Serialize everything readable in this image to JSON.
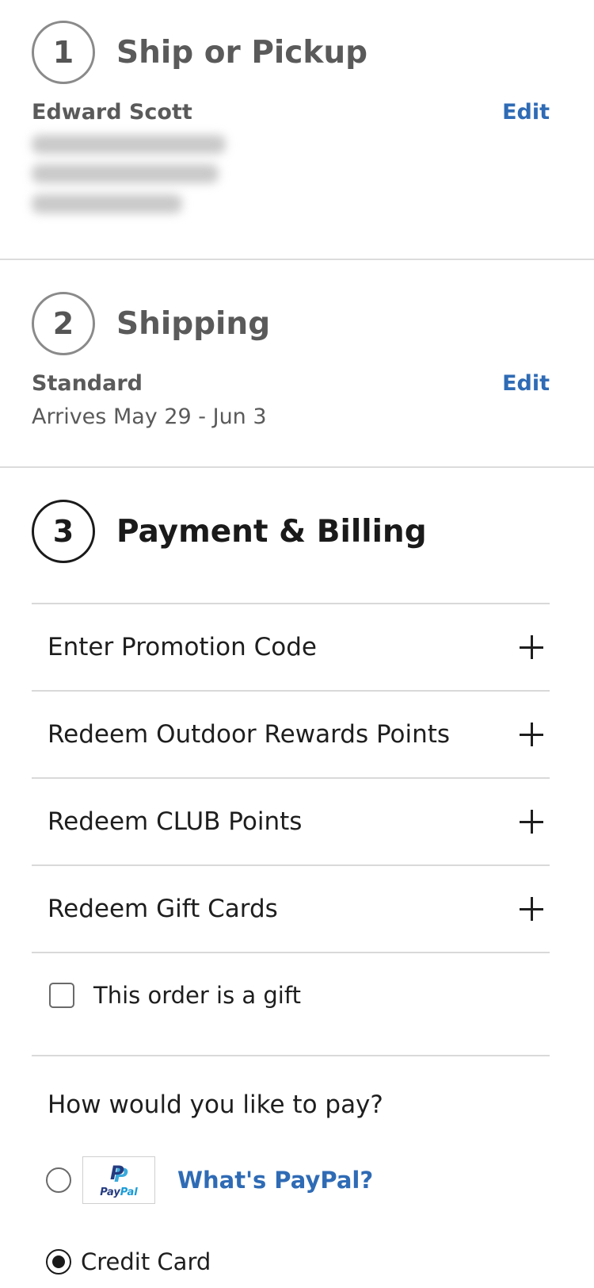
{
  "ship_or_pickup": {
    "step_number": "1",
    "title": "Ship or Pickup",
    "customer_name": "Edward Scott",
    "edit_label": "Edit"
  },
  "shipping": {
    "step_number": "2",
    "title": "Shipping",
    "method": "Standard",
    "arrival": "Arrives May 29 - Jun 3",
    "edit_label": "Edit"
  },
  "payment": {
    "step_number": "3",
    "title": "Payment & Billing",
    "options": [
      {
        "label": "Enter Promotion Code",
        "icon": "plus-icon"
      },
      {
        "label": "Redeem Outdoor Rewards Points",
        "icon": "plus-icon"
      },
      {
        "label": "Redeem CLUB Points",
        "icon": "plus-icon"
      },
      {
        "label": "Redeem Gift Cards",
        "icon": "plus-icon"
      }
    ],
    "gift_label": "This order is a gift",
    "gift_checked": false,
    "pay_question": "How would you like to pay?",
    "paypal_logo_text": "PayPal",
    "paypal_link": "What's PayPal?",
    "credit_card_label": "Credit Card",
    "selected_method": "Credit Card"
  },
  "colors": {
    "link": "#2f6bb5",
    "inactive_text": "#5a5a5a",
    "active_text": "#1a1a1a"
  }
}
